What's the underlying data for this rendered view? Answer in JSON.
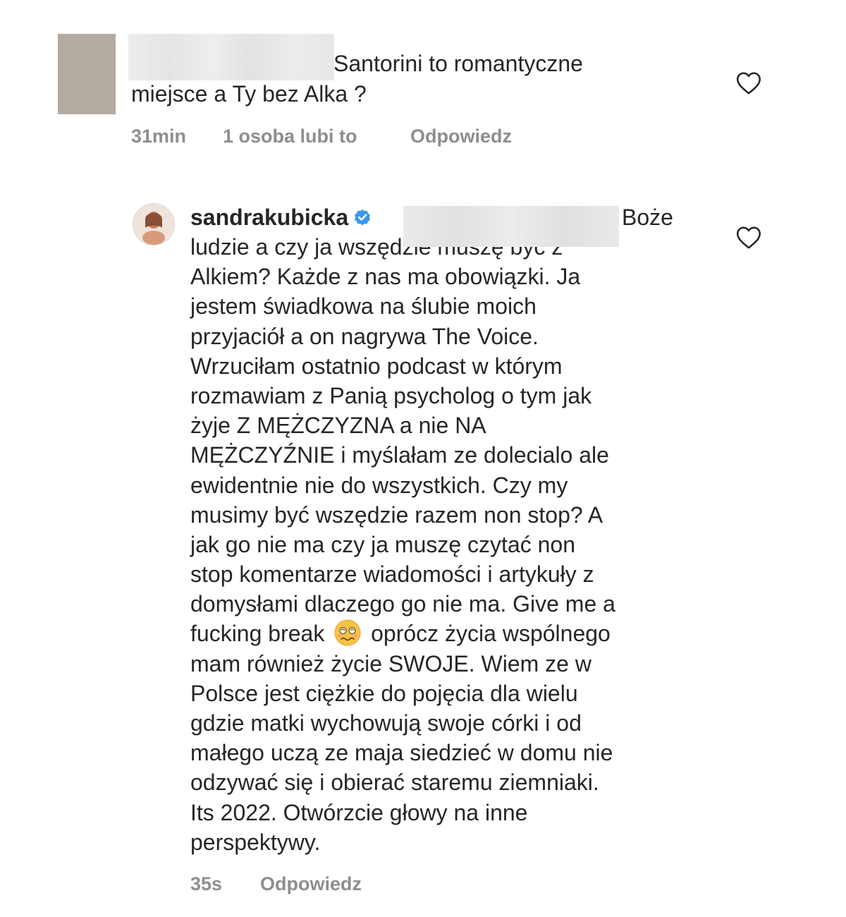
{
  "comment": {
    "text_line1": "Santorini to romantyczne",
    "text_line2": "miejsce a Ty bez Alka ?",
    "time": "31min",
    "likes": "1 osoba lubi to",
    "reply_label": "Odpowiedz",
    "like_icon": "heart-outline"
  },
  "reply": {
    "username": "sandrakubicka",
    "verified_icon": "verified-badge",
    "first_line_tail": "Boże",
    "lines": [
      "ludzie a czy ja wszędzie muszę być z",
      "Alkiem? Każde z nas ma obowiązki. Ja",
      "jestem świadkowa na ślubie moich",
      "przyjaciół a on nagrywa The Voice.",
      "Wrzuciłam ostatnio podcast w którym",
      "rozmawiam z Panią psycholog o tym jak",
      "żyje Z MĘŻCZYZNA a nie NA",
      "MĘŻCZYŹNIE i myślałam ze dolecialo ale",
      "ewidentnie nie do wszystkich. Czy my",
      "musimy być wszędzie razem non stop? A",
      "jak go nie ma czy ja muszę czytać non",
      "stop komentarze wiadomości i artykuły z",
      "domysłami dlaczego go nie ma. Give me a"
    ],
    "emoji_line_before": "fucking break",
    "emoji_line_after": "oprócz życia wspólnego",
    "emoji_icon": "woozy-face-emoji",
    "lines_after": [
      "mam również życie SWOJE. Wiem ze w",
      "Polsce jest ciężkie do pojęcia dla wielu",
      "gdzie matki wychowują swoje córki i od",
      "małego uczą ze maja siedzieć w domu nie",
      "odzywać się i obierać staremu ziemniaki.",
      "Its 2022. Otwórzcie głowy na inne",
      "perspektywy."
    ],
    "time": "35s",
    "reply_label": "Odpowiedz",
    "like_icon": "heart-outline"
  }
}
